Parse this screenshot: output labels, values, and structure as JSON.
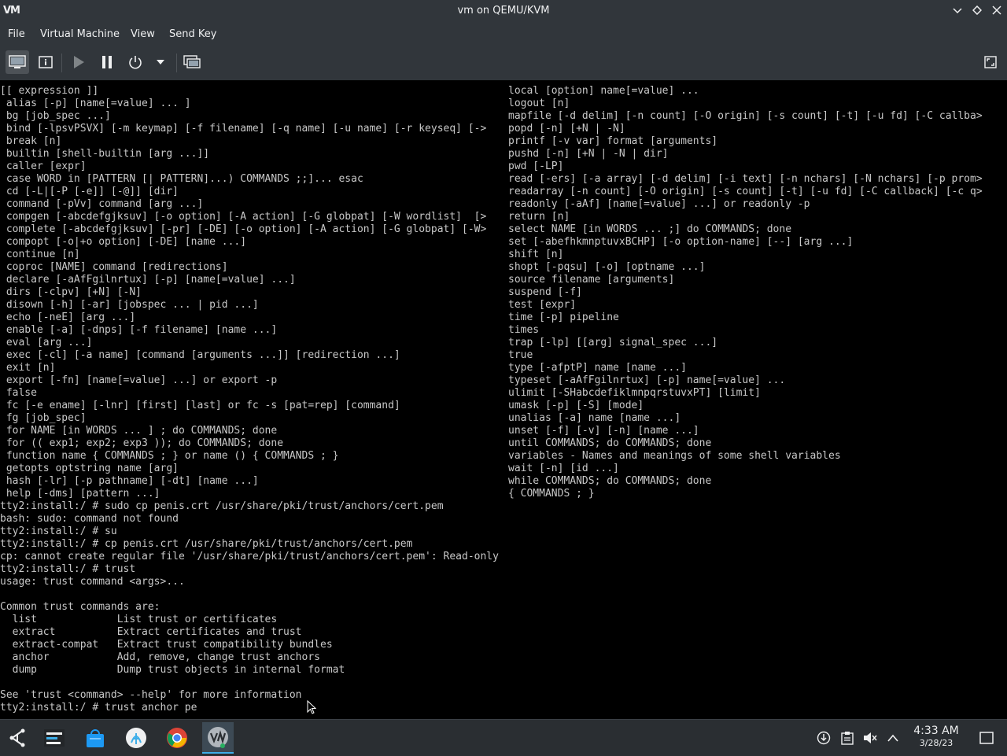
{
  "window": {
    "app_logo": "VM",
    "title": "vm on QEMU/KVM",
    "controls": [
      "minimize",
      "maximize",
      "close"
    ]
  },
  "menubar": {
    "file": "File",
    "virtual_machine": "Virtual Machine",
    "view": "View",
    "send_key": "Send Key"
  },
  "toolbar": {
    "icons": [
      "console-icon",
      "details-icon",
      "run-icon",
      "pause-icon",
      "power-icon",
      "power-menu-chevron-icon",
      "snapshots-icon",
      "fullscreen-icon"
    ]
  },
  "console": {
    "left": [
      "[[ expression ]]",
      " alias [-p] [name[=value] ... ]",
      " bg [job_spec ...]",
      " bind [-lpsvPSVX] [-m keymap] [-f filename] [-q name] [-u name] [-r keyseq] [->",
      " break [n]",
      " builtin [shell-builtin [arg ...]]",
      " caller [expr]",
      " case WORD in [PATTERN [| PATTERN]...) COMMANDS ;;]... esac",
      " cd [-L|[-P [-e]] [-@]] [dir]",
      " command [-pVv] command [arg ...]",
      " compgen [-abcdefgjksuv] [-o option] [-A action] [-G globpat] [-W wordlist]  [>",
      " complete [-abcdefgjksuv] [-pr] [-DE] [-o option] [-A action] [-G globpat] [-W>",
      " compopt [-o|+o option] [-DE] [name ...]",
      " continue [n]",
      " coproc [NAME] command [redirections]",
      " declare [-aAfFgilnrtux] [-p] [name[=value] ...]",
      " dirs [-clpv] [+N] [-N]",
      " disown [-h] [-ar] [jobspec ... | pid ...]",
      " echo [-neE] [arg ...]",
      " enable [-a] [-dnps] [-f filename] [name ...]",
      " eval [arg ...]",
      " exec [-cl] [-a name] [command [arguments ...]] [redirection ...]",
      " exit [n]",
      " export [-fn] [name[=value] ...] or export -p",
      " false",
      " fc [-e ename] [-lnr] [first] [last] or fc -s [pat=rep] [command]",
      " fg [job_spec]",
      " for NAME [in WORDS ... ] ; do COMMANDS; done",
      " for (( exp1; exp2; exp3 )); do COMMANDS; done",
      " function name { COMMANDS ; } or name () { COMMANDS ; }",
      " getopts optstring name [arg]",
      " hash [-lr] [-p pathname] [-dt] [name ...]",
      " help [-dms] [pattern ...]",
      "tty2:install:/ # sudo cp penis.crt /usr/share/pki/trust/anchors/cert.pem",
      "bash: sudo: command not found",
      "tty2:install:/ # su",
      "tty2:install:/ # cp penis.crt /usr/share/pki/trust/anchors/cert.pem",
      "cp: cannot create regular file '/usr/share/pki/trust/anchors/cert.pem': Read-only file system",
      "tty2:install:/ # trust",
      "usage: trust command <args>...",
      "",
      "Common trust commands are:",
      "  list             List trust or certificates",
      "  extract          Extract certificates and trust",
      "  extract-compat   Extract trust compatibility bundles",
      "  anchor           Add, remove, change trust anchors",
      "  dump             Dump trust objects in internal format",
      "",
      "See 'trust <command> --help' for more information",
      "tty2:install:/ # trust anchor pe"
    ],
    "right": [
      "local [option] name[=value] ...",
      "logout [n]",
      "mapfile [-d delim] [-n count] [-O origin] [-s count] [-t] [-u fd] [-C callba>",
      "popd [-n] [+N | -N]",
      "printf [-v var] format [arguments]",
      "pushd [-n] [+N | -N | dir]",
      "pwd [-LP]",
      "read [-ers] [-a array] [-d delim] [-i text] [-n nchars] [-N nchars] [-p prom>",
      "readarray [-n count] [-O origin] [-s count] [-t] [-u fd] [-C callback] [-c q>",
      "readonly [-aAf] [name[=value] ...] or readonly -p",
      "return [n]",
      "select NAME [in WORDS ... ;] do COMMANDS; done",
      "set [-abefhkmnptuvxBCHP] [-o option-name] [--] [arg ...]",
      "shift [n]",
      "shopt [-pqsu] [-o] [optname ...]",
      "source filename [arguments]",
      "suspend [-f]",
      "test [expr]",
      "time [-p] pipeline",
      "times",
      "trap [-lp] [[arg] signal_spec ...]",
      "true",
      "type [-afptP] name [name ...]",
      "typeset [-aAfFgilnrtux] [-p] name[=value] ...",
      "ulimit [-SHabcdefiklmnpqrstuvxPT] [limit]",
      "umask [-p] [-S] [mode]",
      "unalias [-a] name [name ...]",
      "unset [-f] [-v] [-n] [name ...]",
      "until COMMANDS; do COMMANDS; done",
      "variables - Names and meanings of some shell variables",
      "wait [-n] [id ...]",
      "while COMMANDS; do COMMANDS; done",
      "{ COMMANDS ; }"
    ]
  },
  "taskbar": {
    "launcher_icon": "app-launcher-icon",
    "tasks": [
      "task-manager-icon",
      "discover-store-icon",
      "app-icon",
      "chrome-icon",
      "virt-manager-icon"
    ],
    "tray": [
      "updates-icon",
      "clipboard-icon",
      "volume-muted-icon",
      "tray-expand-icon"
    ],
    "clock_time": "4:33 AM",
    "clock_date": "3/28/23"
  },
  "colors": {
    "chrome": "#31363b",
    "terminal_bg": "#000000",
    "terminal_fg": "#c8c8c8",
    "accent": "#3daee9"
  }
}
